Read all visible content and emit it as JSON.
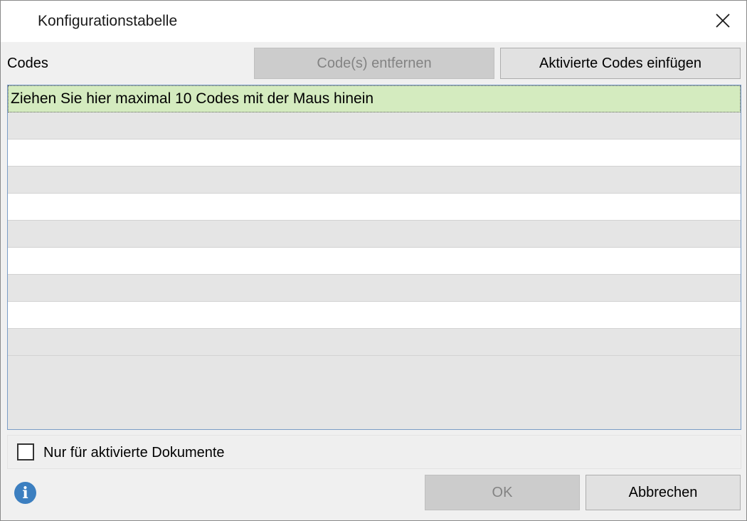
{
  "window": {
    "title": "Konfigurationstabelle"
  },
  "toolbar": {
    "codes_label": "Codes",
    "remove_label": "Code(s) entfernen",
    "insert_label": "Aktivierte Codes einfügen"
  },
  "grid": {
    "hint": "Ziehen Sie hier maximal 10 Codes mit der Maus hinein"
  },
  "options": {
    "only_activated_label": "Nur für aktivierte Dokumente",
    "only_activated_checked": false
  },
  "footer": {
    "info_icon": "i",
    "ok_label": "OK",
    "cancel_label": "Abbrechen"
  },
  "icons": {
    "close": "close-icon",
    "info": "info-icon"
  },
  "colors": {
    "hint_row": "#d4ebbf",
    "info": "#3c7fc0",
    "grid_border": "#7a9cc6"
  }
}
